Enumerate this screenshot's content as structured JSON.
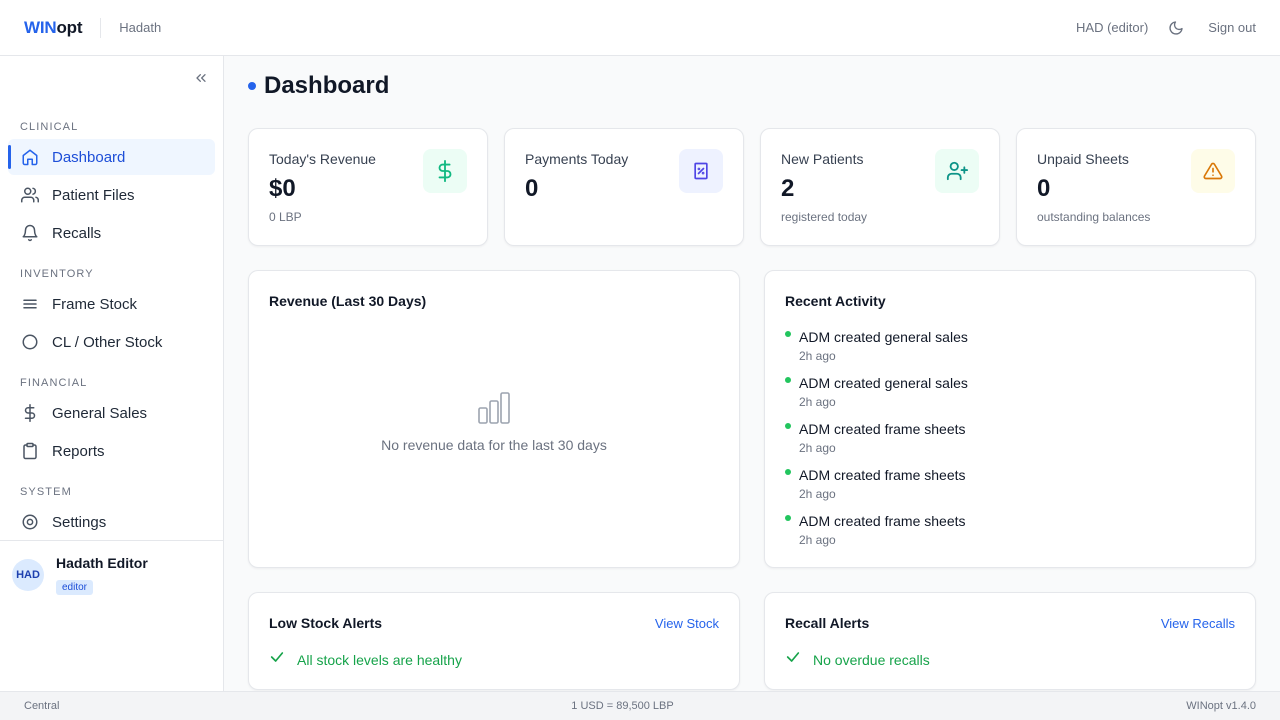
{
  "header": {
    "brand_part1": "WIN",
    "brand_part2": "opt",
    "org": "Hadath",
    "user_role": "HAD (editor)",
    "sign_out": "Sign out",
    "theme_icon": "moon-icon"
  },
  "sidebar": {
    "sections": {
      "clinical": "CLINICAL",
      "inventory": "INVENTORY",
      "financial": "FINANCIAL",
      "system": "SYSTEM"
    },
    "items": [
      {
        "label": "Dashboard",
        "icon": "home-icon",
        "active": true
      },
      {
        "label": "Patient Files",
        "icon": "users-icon"
      },
      {
        "label": "Recalls",
        "icon": "bell-icon"
      },
      {
        "label": "Frame Stock",
        "icon": "list-icon"
      },
      {
        "label": "CL / Other Stock",
        "icon": "circle-icon"
      },
      {
        "label": "General Sales",
        "icon": "dollar-icon"
      },
      {
        "label": "Reports",
        "icon": "clipboard-icon"
      },
      {
        "label": "Settings",
        "icon": "settings-icon"
      }
    ],
    "user": {
      "initials": "HAD",
      "name": "Hadath Editor",
      "role": "editor"
    }
  },
  "main": {
    "title": "Dashboard",
    "stats": [
      {
        "label": "Today's Revenue",
        "value": "$0",
        "sub": "0 LBP",
        "icon": "dollar-icon",
        "icon_bg": "#ecfdf5",
        "icon_color": "#10b981"
      },
      {
        "label": "Payments Today",
        "value": "0",
        "sub": "",
        "icon": "receipt-icon",
        "icon_bg": "#eef2ff",
        "icon_color": "#4f46e5"
      },
      {
        "label": "New Patients",
        "value": "2",
        "sub": "registered today",
        "icon": "user-plus-icon",
        "icon_bg": "#ecfdf5",
        "icon_color": "#0d9488"
      },
      {
        "label": "Unpaid Sheets",
        "value": "0",
        "sub": "outstanding balances",
        "icon": "alert-triangle-icon",
        "icon_bg": "#fefce8",
        "icon_color": "#d97706"
      }
    ],
    "revenue": {
      "title": "Revenue (Last 30 Days)",
      "empty_text": "No revenue data for the last 30 days"
    },
    "activity": {
      "title": "Recent Activity",
      "items": [
        {
          "text": "ADM created general sales",
          "time": "2h ago"
        },
        {
          "text": "ADM created general sales",
          "time": "2h ago"
        },
        {
          "text": "ADM created frame sheets",
          "time": "2h ago"
        },
        {
          "text": "ADM created frame sheets",
          "time": "2h ago"
        },
        {
          "text": "ADM created frame sheets",
          "time": "2h ago"
        }
      ]
    },
    "low_stock": {
      "title": "Low Stock Alerts",
      "link": "View Stock",
      "status": "All stock levels are healthy"
    },
    "recall": {
      "title": "Recall Alerts",
      "link": "View Recalls",
      "status": "No overdue recalls"
    }
  },
  "footer": {
    "location": "Central",
    "rate": "1 USD = 89,500 LBP",
    "version": "WINopt v1.4.0"
  },
  "colors": {
    "accent": "#2563eb",
    "success": "#16a34a"
  }
}
